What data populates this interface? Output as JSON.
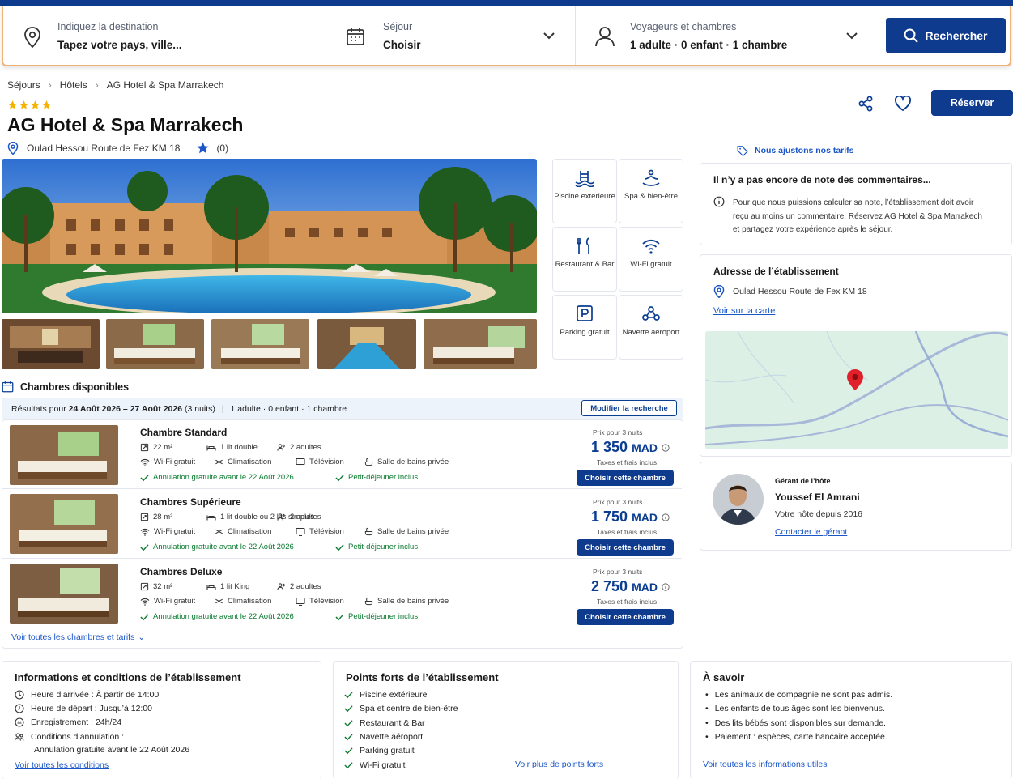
{
  "search": {
    "destination_label": "Indiquez la destination",
    "destination_value": "Tapez votre pays, ville...",
    "stay_label": "Séjour",
    "stay_value": "Choisir",
    "guests_label": "Voyageurs et chambres",
    "guests_value": "1 adulte · 0 enfant · 1 chambre",
    "button": "Rechercher"
  },
  "breadcrumb": [
    "Séjours",
    "Hôtels",
    "AG Hotel & Spa Marrakech"
  ],
  "hotel": {
    "stars": 4,
    "name": "AG Hotel & Spa Marrakech",
    "address": "Oulad Hessou Route de Fez KM 18",
    "rating_count": "(0)",
    "reserve": "Réserver"
  },
  "amenities": [
    {
      "icon": "pool-icon",
      "label": "Piscine extérieure"
    },
    {
      "icon": "spa-icon",
      "label": "Spa & bien-être"
    },
    {
      "icon": "restaurant-icon",
      "label": "Restaurant & Bar"
    },
    {
      "icon": "wifi-icon",
      "label": "Wi-Fi gratuit"
    },
    {
      "icon": "parking-icon",
      "label": "Parking gratuit"
    },
    {
      "icon": "shuttle-icon",
      "label": "Navette aéroport"
    }
  ],
  "rooms_section": {
    "title": "Chambres disponibles",
    "results_prefix": "Résultats pour",
    "results_dates": "24 Août 2026 – 27 Août 2026",
    "results_nights": "(3 nuits)",
    "results_guests": "1 adulte · 0 enfant · 1 chambre",
    "modify": "Modifier la recherche",
    "see_all": "Voir toutes les chambres et tarifs"
  },
  "rooms": [
    {
      "name": "Chambre Standard",
      "size": "22 m²",
      "bed": "1 lit double",
      "guests": "2 adultes",
      "wifi": "Wi-Fi gratuit",
      "ac": "Climatisation",
      "tv": "Télévision",
      "bath": "Salle de bains privée",
      "cancel": "Annulation gratuite avant le 22 Août 2026",
      "breakfast": "Petit-déjeuner inclus",
      "price_label": "Prix pour 3 nuits",
      "price": "1 350",
      "currency": "MAD",
      "tax": "Taxes et frais inclus",
      "button": "Choisir cette chambre"
    },
    {
      "name": "Chambres Supérieure",
      "size": "28 m²",
      "bed": "1 lit double ou 2 lits simples",
      "guests": "2 adultes",
      "wifi": "Wi-Fi gratuit",
      "ac": "Climatisation",
      "tv": "Télévision",
      "bath": "Salle de bains privée",
      "cancel": "Annulation gratuite avant le 22 Août 2026",
      "breakfast": "Petit-déjeuner inclus",
      "price_label": "Prix pour 3 nuits",
      "price": "1 750",
      "currency": "MAD",
      "tax": "Taxes et frais inclus",
      "button": "Choisir cette chambre"
    },
    {
      "name": "Chambres Deluxe",
      "size": "32 m²",
      "bed": "1 lit King",
      "guests": "2 adultes",
      "wifi": "Wi-Fi gratuit",
      "ac": "Climatisation",
      "tv": "Télévision",
      "bath": "Salle de bains privée",
      "cancel": "Annulation gratuite avant le 22 Août 2026",
      "breakfast": "Petit-déjeuner inclus",
      "price_label": "Prix pour 3 nuits",
      "price": "2 750",
      "currency": "MAD",
      "tax": "Taxes et frais inclus",
      "button": "Choisir cette chambre"
    }
  ],
  "right": {
    "price_adjust": "Nous ajustons nos tarifs",
    "reviews_title": "Il n’y a pas encore de note des commentaires...",
    "reviews_text_1": "Pour que nous puissions calculer sa note, l’établissement doit avoir",
    "reviews_text_2": "reçu au moins un commentaire. Réservez AG Hotel & Spa Marrakech",
    "reviews_text_3": "et partagez votre expérience après le séjour.",
    "address_title": "Adresse de l’établissement",
    "address": "Oulad Hessou Route de Fex KM 18",
    "map_link": "Voir sur la carte",
    "host_label": "Gérant de l’hôte",
    "host_name": "Youssef El Amrani",
    "host_since": "Votre hôte depuis 2016",
    "host_contact": "Contacter le gérant"
  },
  "info": {
    "title": "Informations et conditions de l’établissement",
    "items": [
      "Heure d’arrivée : À partir de 14:00",
      "Heure de départ : Jusqu’à 12:00",
      "Enregistrement : 24h/24",
      "Conditions d’annulation :"
    ],
    "cancel_detail": "Annulation gratuite avant le 22 Août 2026",
    "link": "Voir toutes les conditions"
  },
  "highlights": {
    "title": "Points forts de l’établissement",
    "items": [
      "Piscine extérieure",
      "Spa et centre de bien-être",
      "Restaurant & Bar",
      "Navette aéroport",
      "Parking gratuit",
      "Wi-Fi gratuit"
    ],
    "link": "Voir plus de points forts"
  },
  "know": {
    "title": "À savoir",
    "items": [
      "Les animaux de compagnie ne sont pas admis.",
      "Les enfants de tous âges sont les bienvenus.",
      "Des lits bébés sont disponibles sur demande.",
      "Paiement : espèces, carte bancaire acceptée."
    ],
    "link": "Voir toutes les informations utiles"
  },
  "colors": {
    "primary": "#0f3b8f",
    "link": "#1a56c8",
    "star": "#f5b301",
    "green": "#0a7a2f",
    "pin": "#e0202a"
  }
}
